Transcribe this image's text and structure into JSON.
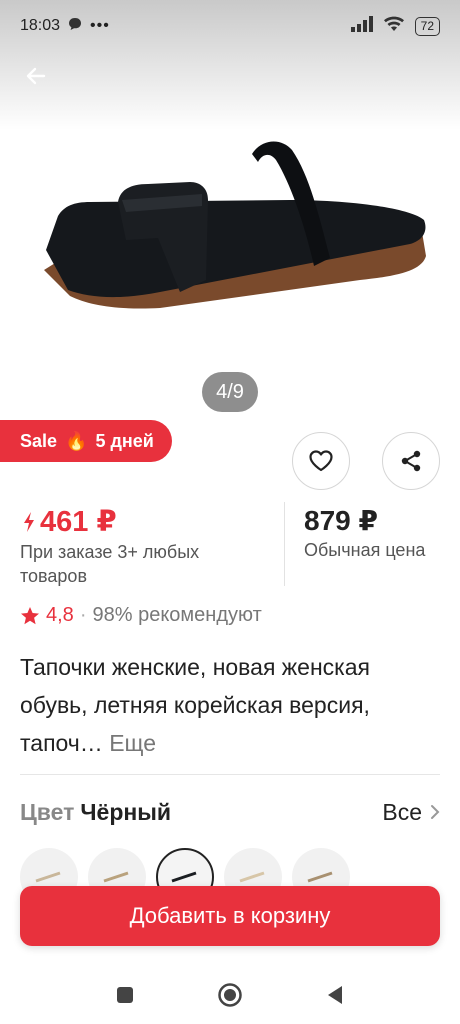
{
  "status": {
    "time": "18:03",
    "battery": "72"
  },
  "gallery": {
    "counter": "4/9"
  },
  "sale": {
    "label": "Sale",
    "days": "5 дней"
  },
  "price": {
    "promo": "461 ₽",
    "promo_note": "При заказе 3+ любых товаров",
    "regular": "879 ₽",
    "regular_note": "Обычная цена"
  },
  "rating": {
    "value": "4,8",
    "separator": "·",
    "recommend": "98% рекомендуют"
  },
  "product": {
    "title": "Тапочки женские, новая женская обувь, летняя корейская версия, тапоч…",
    "more": "Еще"
  },
  "color": {
    "label": "Цвет",
    "value": "Чёрный",
    "all": "Все"
  },
  "cart": {
    "button_label": "Добавить в корзину"
  },
  "colors": {
    "accent": "#e8313d"
  }
}
